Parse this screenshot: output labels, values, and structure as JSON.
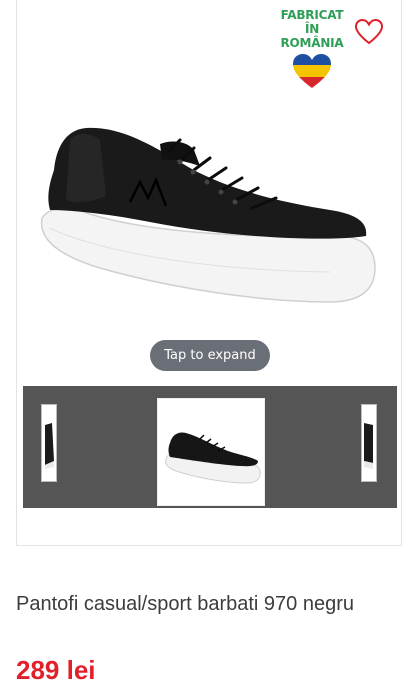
{
  "badge": {
    "line1": "FABRICAT ÎN",
    "line2": "ROMÂNIA",
    "flag_colors": [
      "#1f4fa0",
      "#f5c400",
      "#d8262e"
    ],
    "text_color": "#2f9e57"
  },
  "wishlist": {
    "icon": "heart-outline-icon",
    "color": "#e0202a"
  },
  "gallery": {
    "expand_label": "Tap to expand",
    "thumbnail_count": 3,
    "selected_index": 1
  },
  "product": {
    "title": "Pantofi casual/sport barbati 970 negru",
    "price": "289 lei",
    "price_color": "#e0202a"
  }
}
